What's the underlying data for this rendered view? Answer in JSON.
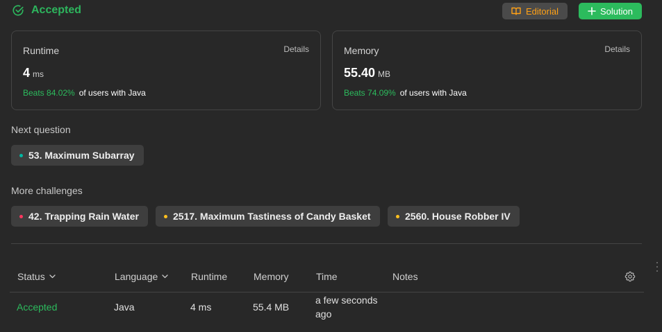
{
  "header": {
    "status": "Accepted",
    "editorial_label": "Editorial",
    "solution_label": "Solution"
  },
  "runtime_card": {
    "label": "Runtime",
    "details": "Details",
    "value": "4",
    "unit": "ms",
    "beats": "Beats 84.02%",
    "suffix": "of users with Java"
  },
  "memory_card": {
    "label": "Memory",
    "details": "Details",
    "value": "55.40",
    "unit": "MB",
    "beats": "Beats 74.09%",
    "suffix": "of users with Java"
  },
  "next_question": {
    "label": "Next question",
    "item": {
      "title": "53. Maximum Subarray",
      "difficulty_color": "#00b8a3"
    }
  },
  "more_challenges": {
    "label": "More challenges",
    "items": [
      {
        "title": "42. Trapping Rain Water",
        "difficulty_color": "#ff375f"
      },
      {
        "title": "2517. Maximum Tastiness of Candy Basket",
        "difficulty_color": "#ffc01e"
      },
      {
        "title": "2560. House Robber IV",
        "difficulty_color": "#ffc01e"
      }
    ]
  },
  "table": {
    "headers": {
      "status": "Status",
      "language": "Language",
      "runtime": "Runtime",
      "memory": "Memory",
      "time": "Time",
      "notes": "Notes"
    },
    "rows": [
      {
        "status": "Accepted",
        "language": "Java",
        "runtime": "4 ms",
        "memory": "55.4 MB",
        "time_line1": "a few seconds",
        "time_line2": "ago"
      }
    ]
  },
  "colors": {
    "accepted": "#2cbb5d",
    "editorial": "#ffa116",
    "background": "#282828"
  }
}
